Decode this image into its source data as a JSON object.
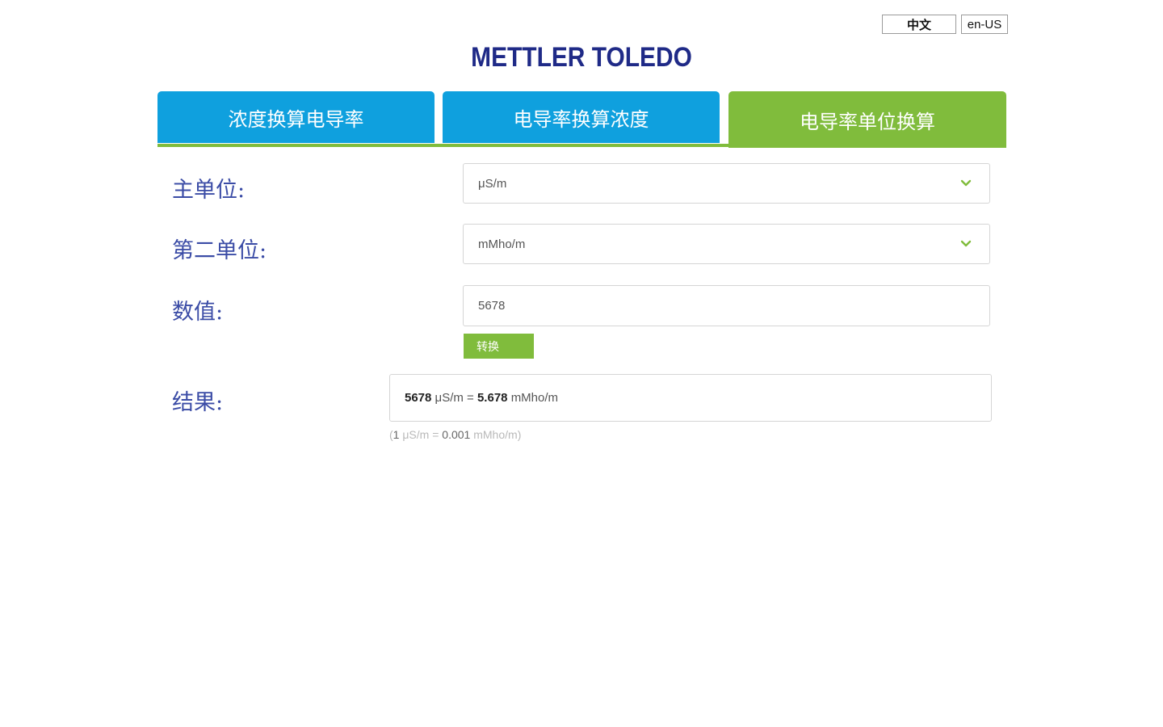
{
  "language": {
    "zh_label": "中文",
    "en_label": "en-US"
  },
  "brand": {
    "logo_text": "METTLER TOLEDO"
  },
  "tabs": [
    {
      "label": "浓度换算电导率",
      "active": false
    },
    {
      "label": "电导率换算浓度",
      "active": false
    },
    {
      "label": "电导率单位换算",
      "active": true
    }
  ],
  "form": {
    "primary_unit_label": "主单位:",
    "primary_unit_value": "μS/m",
    "secondary_unit_label": "第二单位:",
    "secondary_unit_value": "mMho/m",
    "value_label": "数值:",
    "value": "5678",
    "convert_label": "转换",
    "result_label": "结果:"
  },
  "result": {
    "input_value": "5678",
    "input_unit": "μS/m",
    "equals": "=",
    "output_value": "5.678",
    "output_unit": "mMho/m",
    "note_open": "(",
    "note_one": "1",
    "note_unit_a": "μS/m",
    "note_equals": "=",
    "note_factor": "0.001",
    "note_unit_b": "mMho/m",
    "note_close": ")"
  },
  "colors": {
    "tab_blue": "#0fa0de",
    "tab_green": "#80bc3c",
    "brand_navy": "#1f2a87",
    "label_blue": "#3b4ca6"
  }
}
